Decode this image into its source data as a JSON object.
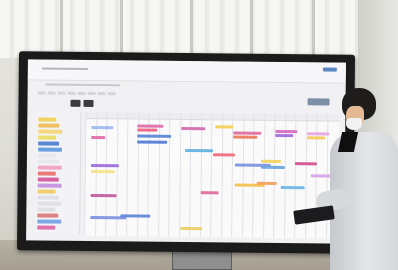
{
  "header": {
    "tabs": [
      {
        "label": ""
      },
      {
        "label": ""
      }
    ],
    "action_label": ""
  },
  "colors": {
    "screen_background": "#f1f1f3",
    "header_button": "#7d8fa6",
    "tab": "#3b3b40",
    "events": [
      "#e8c05a",
      "#5a7fd6",
      "#d85a9a",
      "#e7855a",
      "#8e6ad8",
      "#61b7e0",
      "#f2d878"
    ]
  },
  "sidebar": {
    "items": [
      {
        "color": "#f0d460"
      },
      {
        "color": "#f0c060"
      },
      {
        "color": "#f4d880"
      },
      {
        "color": "#e8e06a"
      },
      {
        "color": "#5a86d2"
      },
      {
        "color": "#6aa0e0"
      },
      {
        "color": "#e8e8ec"
      },
      {
        "color": "#e8e8ec"
      },
      {
        "color": "#f0a8c8"
      },
      {
        "color": "#e87a7a"
      },
      {
        "color": "#d860a0"
      },
      {
        "color": "#c898e0"
      },
      {
        "color": "#f2d070"
      },
      {
        "color": "#e0e0e6"
      },
      {
        "color": "#e0e0e6"
      },
      {
        "color": "#e0e0e6"
      },
      {
        "color": "#e08080"
      },
      {
        "color": "#7fa8e6"
      },
      {
        "color": "#e070a8"
      }
    ]
  },
  "calendar": {
    "events": [
      {
        "color": "#9ab8f0"
      },
      {
        "color": "#e16aa8"
      },
      {
        "color": "#e16aa8"
      },
      {
        "color": "#f06080"
      },
      {
        "color": "#d16aae"
      },
      {
        "color": "#f3cf55"
      },
      {
        "color": "#5a86d6"
      },
      {
        "color": "#4f7ad6"
      },
      {
        "color": "#e06aa0"
      },
      {
        "color": "#e87a5a"
      },
      {
        "color": "#d66ac0"
      },
      {
        "color": "#9f6ae0"
      },
      {
        "color": "#e8a4e0"
      },
      {
        "color": "#f2c95a"
      },
      {
        "color": "#61b0e0"
      },
      {
        "color": "#f06a7a"
      },
      {
        "color": "#7a92e0"
      },
      {
        "color": "#f4d35c"
      },
      {
        "color": "#6aa4e2"
      },
      {
        "color": "#d24f8c"
      },
      {
        "color": "#9b6ae0"
      },
      {
        "color": "#f6df86"
      },
      {
        "color": "#f2c14e"
      },
      {
        "color": "#6ab6e2"
      },
      {
        "color": "#c05a9c"
      },
      {
        "color": "#7e8fe0"
      },
      {
        "color": "#e06a9a"
      },
      {
        "color": "#f0a058"
      },
      {
        "color": "#d9a2e6"
      },
      {
        "color": "#5e86d8"
      },
      {
        "color": "#e8cf66"
      }
    ]
  }
}
